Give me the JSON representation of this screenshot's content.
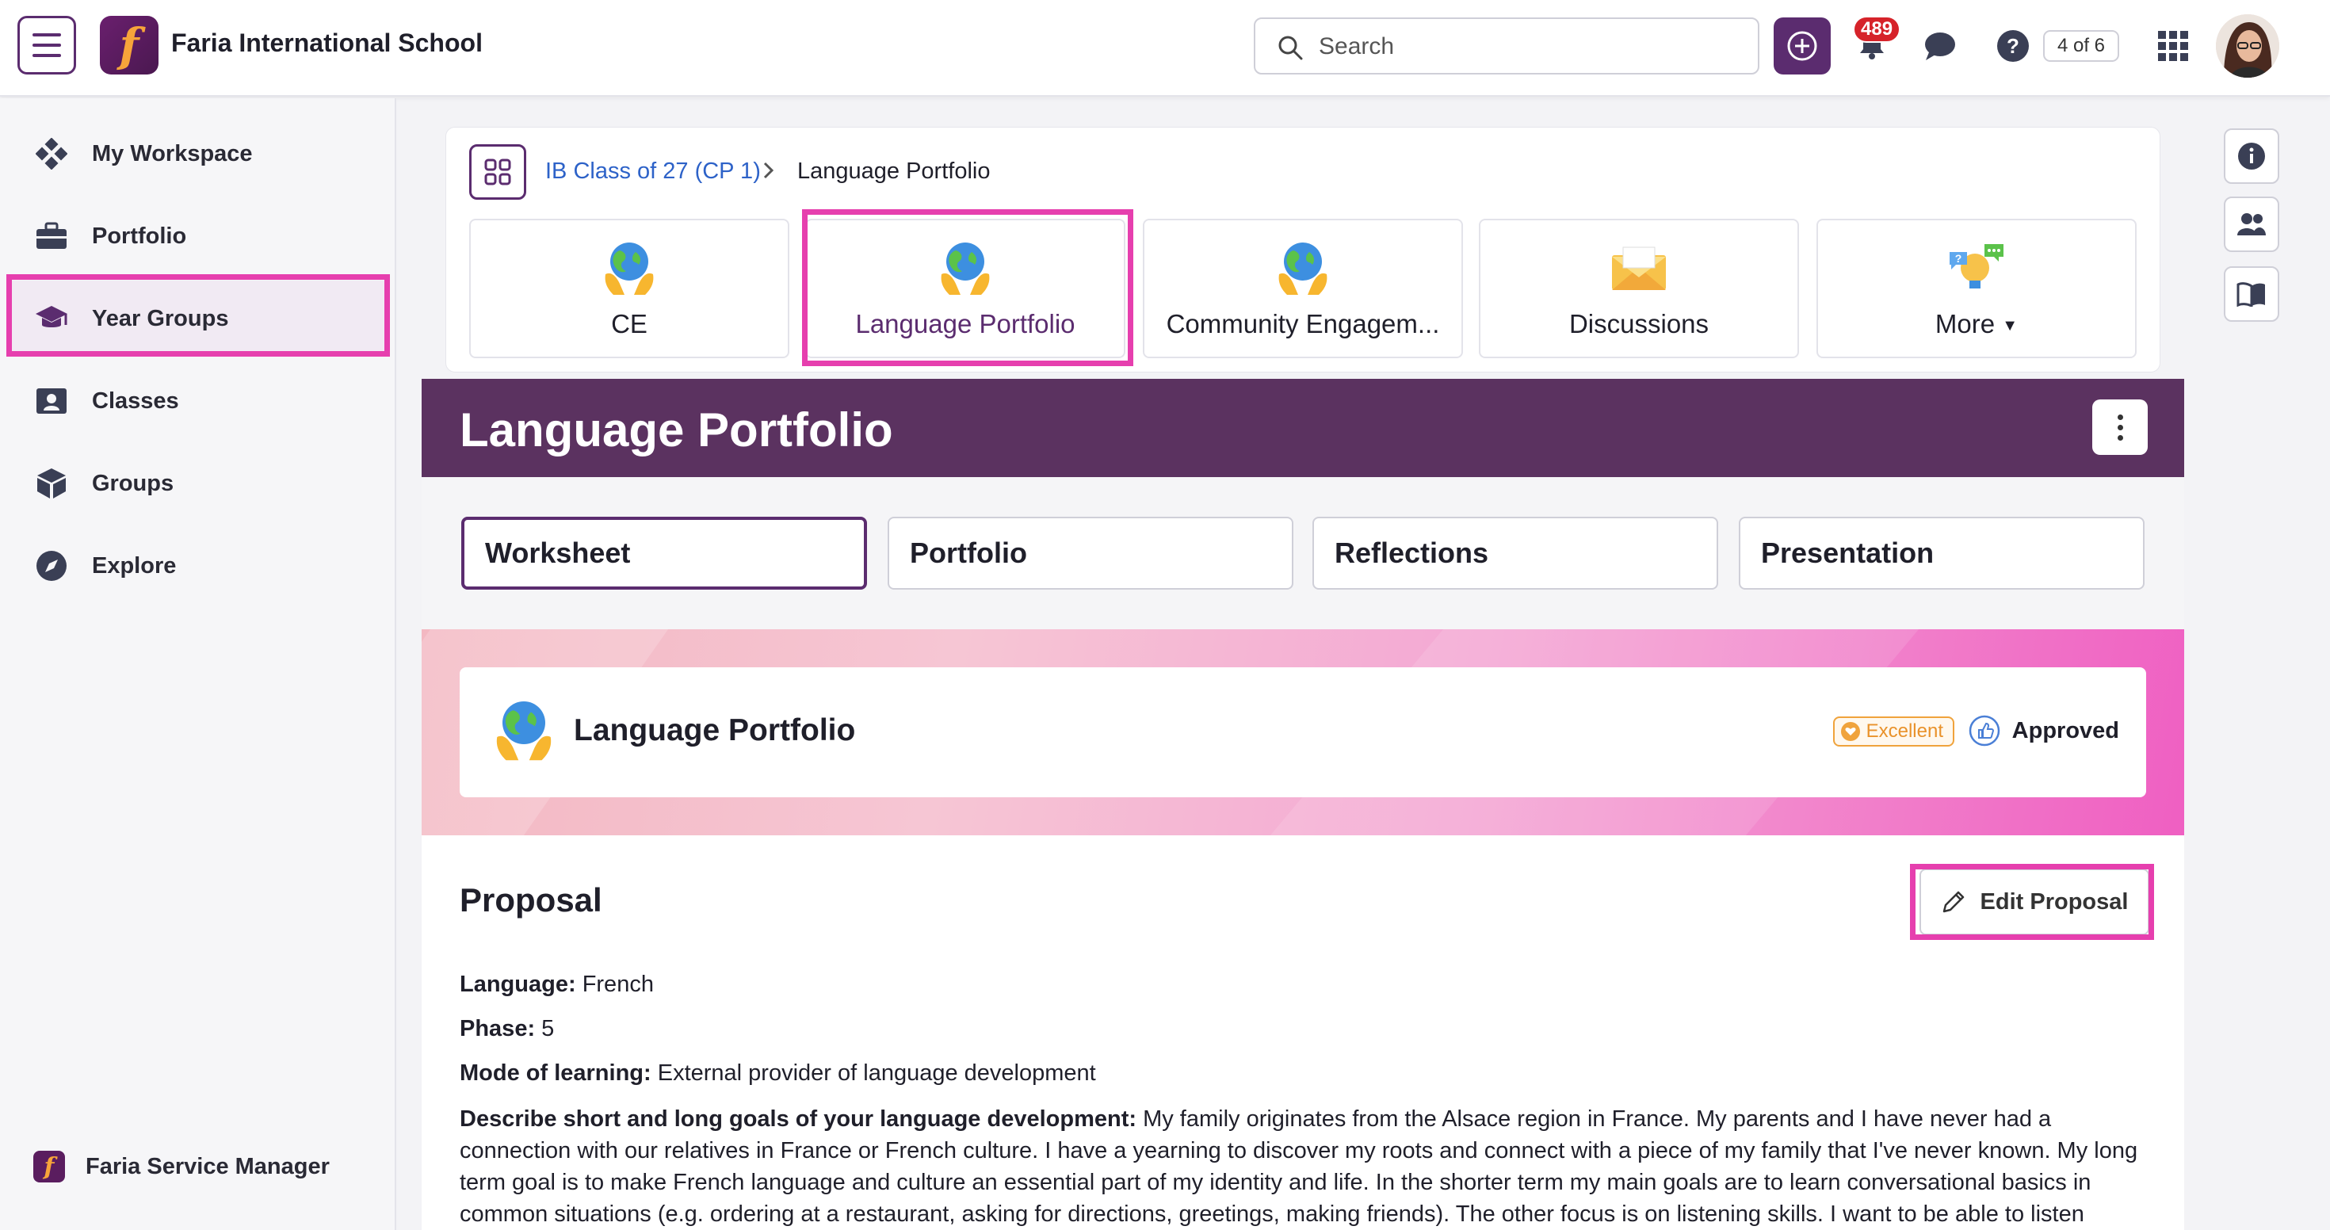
{
  "app": {
    "school_name": "Faria International School",
    "search_placeholder": "Search",
    "notifications_count": "489",
    "page_counter": "4 of 6"
  },
  "sidebar": {
    "items": [
      {
        "label": "My Workspace",
        "icon": "workspace-icon"
      },
      {
        "label": "Portfolio",
        "icon": "briefcase-icon"
      },
      {
        "label": "Year Groups",
        "icon": "graduation-cap-icon"
      },
      {
        "label": "Classes",
        "icon": "classes-icon"
      },
      {
        "label": "Groups",
        "icon": "cube-icon"
      },
      {
        "label": "Explore",
        "icon": "compass-icon"
      }
    ],
    "active": "Year Groups",
    "footer_label": "Faria Service Manager"
  },
  "breadcrumb": {
    "link": "IB Class of 27 (CP 1)",
    "separator": ">",
    "current": "Language Portfolio"
  },
  "tiles": [
    {
      "label": "CE",
      "icon": "globe-hands-icon"
    },
    {
      "label": "Language Portfolio",
      "icon": "globe-hands-icon"
    },
    {
      "label": "Community Engagem...",
      "icon": "globe-hands-icon"
    },
    {
      "label": "Discussions",
      "icon": "envelope-icon"
    },
    {
      "label": "More",
      "icon": "ideas-icon"
    }
  ],
  "page": {
    "title": "Language Portfolio"
  },
  "subtabs": [
    "Worksheet",
    "Portfolio",
    "Reflections",
    "Presentation"
  ],
  "banner": {
    "title": "Language Portfolio",
    "rating": "Excellent",
    "status": "Approved"
  },
  "proposal": {
    "heading": "Proposal",
    "edit_label": "Edit Proposal",
    "language_label": "Language:",
    "language_value": "French",
    "phase_label": "Phase:",
    "phase_value": "5",
    "mode_label": "Mode of learning:",
    "mode_value": "External provider of language development",
    "goals_label": "Describe short and long goals of your language development:",
    "goals_value": "My family originates from the Alsace region in France. My parents and I have never had a connection with our relatives in France or French culture. I have a yearning to discover my roots and connect with a piece of my family that I've never known. My long term goal is to make French language and culture an essential part of my identity and life. In the shorter term my main goals are to learn conversational basics in common situations (e.g. ordering at a restaurant, asking for directions, greetings, making friends). The other focus is on listening skills. I want to be able to listen"
  },
  "colors": {
    "brand_purple": "#5b2c6f",
    "header_purple": "#5b3260",
    "highlight_pink": "#e63fae",
    "link_blue": "#2d62c8",
    "badge_red": "#d6232a",
    "excellent_orange": "#f0a33c"
  }
}
